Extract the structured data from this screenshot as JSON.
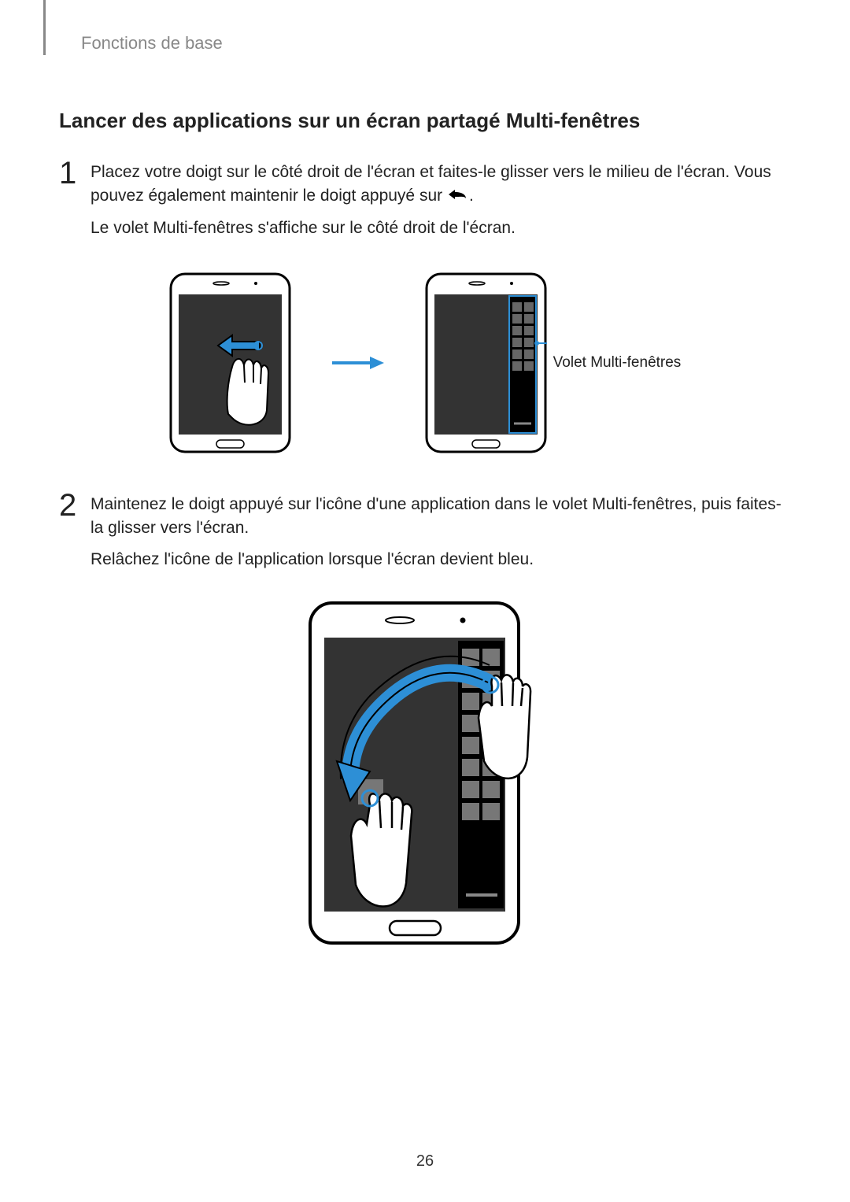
{
  "header": "Fonctions de base",
  "title": "Lancer des applications sur un écran partagé Multi-fenêtres",
  "steps": [
    {
      "num": "1",
      "text_before_icon": "Placez votre doigt sur le côté droit de l'écran et faites-le glisser vers le milieu de l'écran. Vous pouvez également maintenir le doigt appuyé sur ",
      "text_after_icon": ".",
      "text2": "Le volet Multi-fenêtres s'affiche sur le côté droit de l'écran."
    },
    {
      "num": "2",
      "text1": "Maintenez le doigt appuyé sur l'icône d'une application dans le volet Multi-fenêtres, puis faites-la glisser vers l'écran.",
      "text2": "Relâchez l'icône de l'application lorsque l'écran devient bleu."
    }
  ],
  "callout1": "Volet Multi-fenêtres",
  "page_number": "26"
}
